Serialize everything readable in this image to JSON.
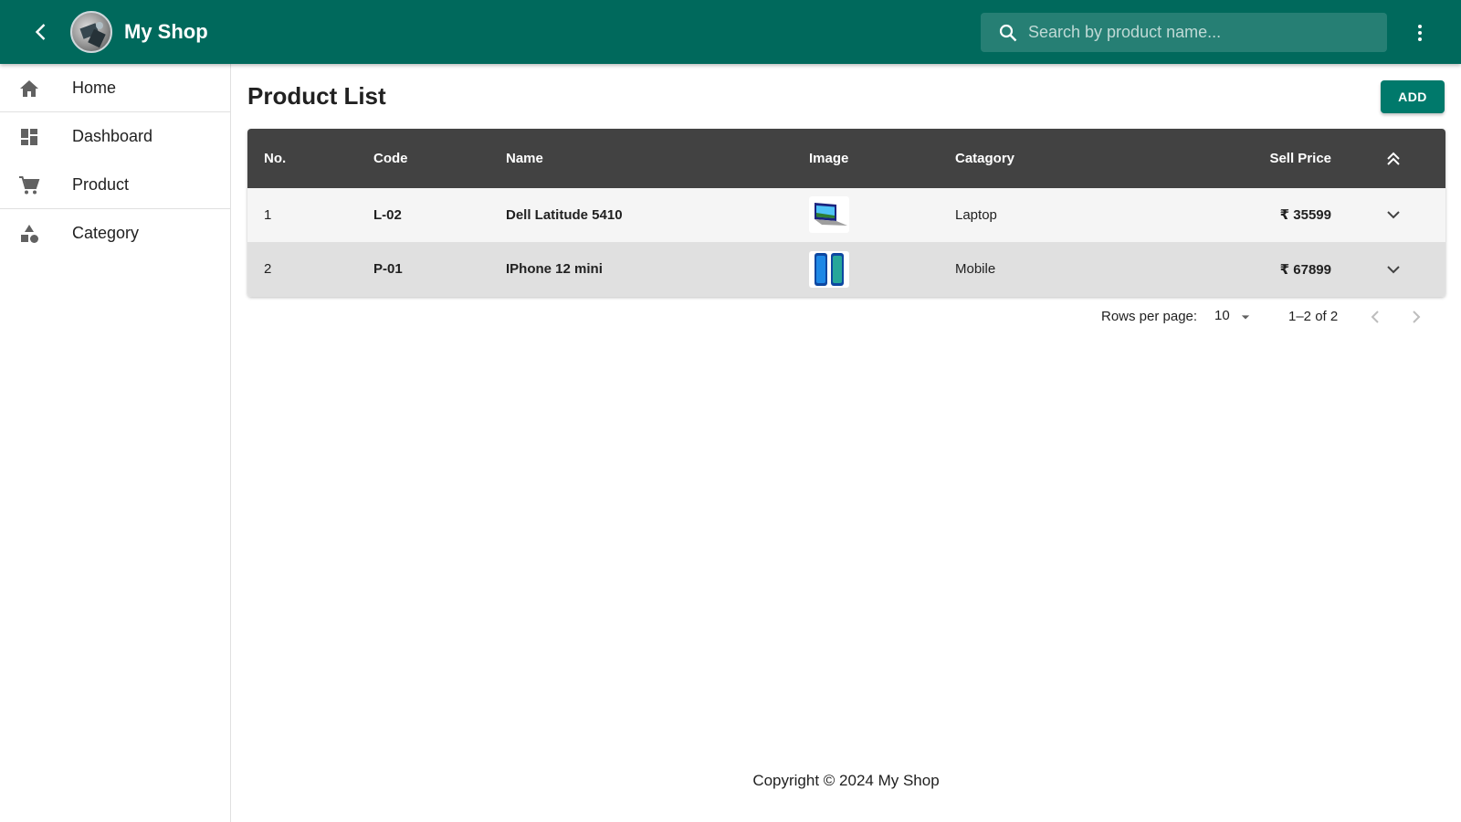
{
  "app": {
    "title": "My Shop",
    "brand_color": "#00695c",
    "search": {
      "placeholder": "Search by product name..."
    }
  },
  "sidebar": {
    "items": [
      {
        "label": "Home",
        "icon": "home-icon"
      },
      {
        "label": "Dashboard",
        "icon": "dashboard-icon"
      },
      {
        "label": "Product",
        "icon": "cart-icon"
      },
      {
        "label": "Category",
        "icon": "category-icon"
      }
    ]
  },
  "main": {
    "title": "Product List",
    "add_label": "ADD",
    "table": {
      "headers": [
        "No.",
        "Code",
        "Name",
        "Image",
        "Catagory",
        "Sell Price"
      ],
      "rows": [
        {
          "no": "1",
          "code": "L-02",
          "name": "Dell Latitude 5410",
          "image": "laptop-image",
          "category": "Laptop",
          "price": "₹ 35599"
        },
        {
          "no": "2",
          "code": "P-01",
          "name": "IPhone 12 mini",
          "image": "phone-image",
          "category": "Mobile",
          "price": "₹ 67899"
        }
      ]
    },
    "pagination": {
      "rows_label": "Rows per page:",
      "rows_value": "10",
      "range": "1–2 of 2"
    },
    "footer": "Copyright © 2024 My Shop"
  }
}
